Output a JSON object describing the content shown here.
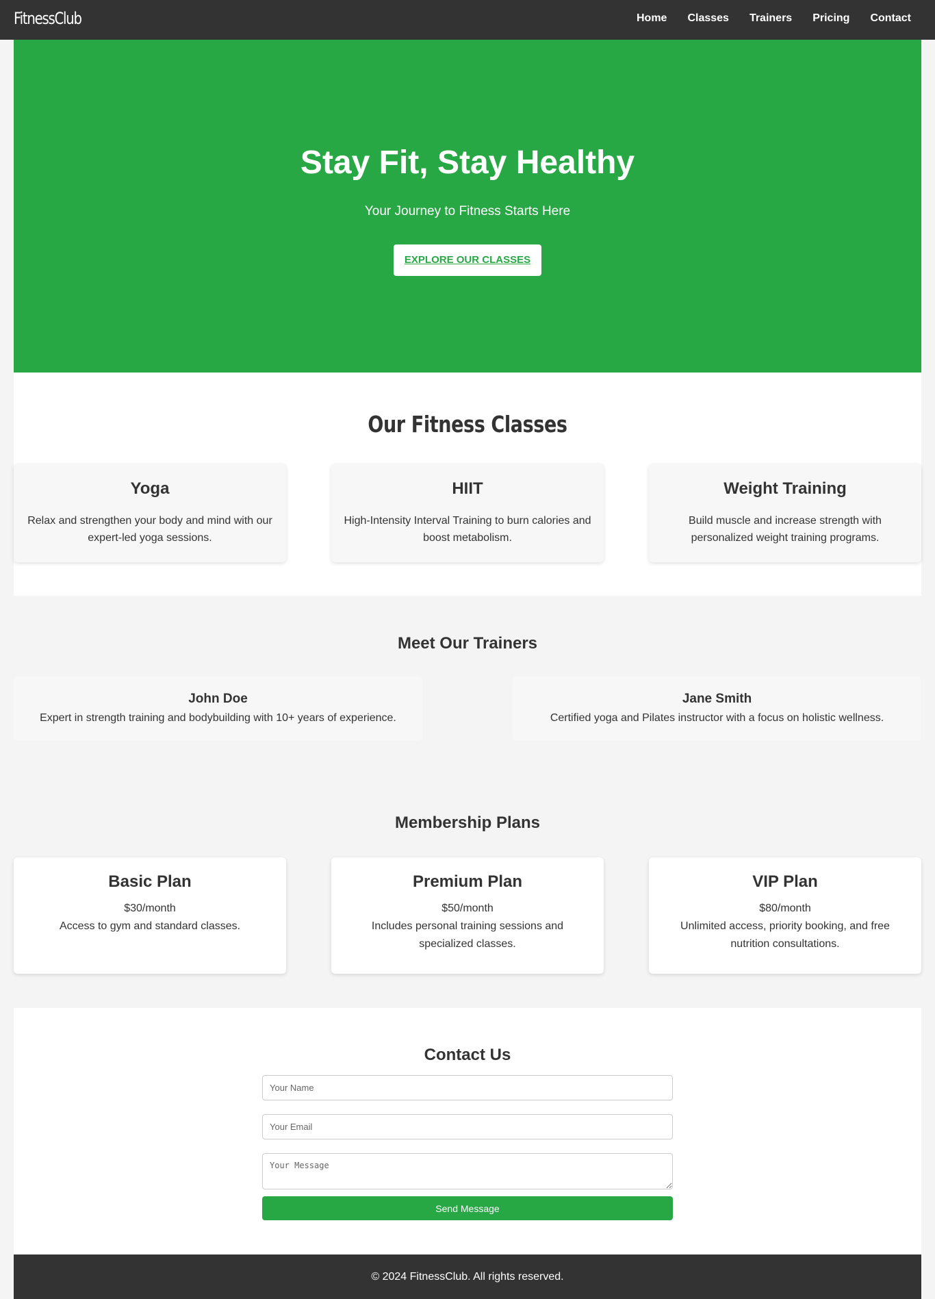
{
  "header": {
    "logo": "FitnessClub",
    "nav": [
      "Home",
      "Classes",
      "Trainers",
      "Pricing",
      "Contact"
    ]
  },
  "hero": {
    "title": "Stay Fit, Stay Healthy",
    "subtitle": "Your Journey to Fitness Starts Here",
    "cta": "EXPLORE OUR CLASSES"
  },
  "classes": {
    "title": "Our Fitness Classes",
    "items": [
      {
        "name": "Yoga",
        "desc": "Relax and strengthen your body and mind with our expert-led yoga sessions."
      },
      {
        "name": "HIIT",
        "desc": "High-Intensity Interval Training to burn calories and boost metabolism."
      },
      {
        "name": "Weight Training",
        "desc": "Build muscle and increase strength with personalized weight training programs."
      }
    ]
  },
  "trainers": {
    "title": "Meet Our Trainers",
    "items": [
      {
        "name": "John Doe",
        "desc": "Expert in strength training and bodybuilding with 10+ years of experience."
      },
      {
        "name": "Jane Smith",
        "desc": "Certified yoga and Pilates instructor with a focus on holistic wellness."
      }
    ]
  },
  "pricing": {
    "title": "Membership Plans",
    "plans": [
      {
        "name": "Basic Plan",
        "price": "$30/month",
        "desc": "Access to gym and standard classes."
      },
      {
        "name": "Premium Plan",
        "price": "$50/month",
        "desc": "Includes personal training sessions and specialized classes."
      },
      {
        "name": "VIP Plan",
        "price": "$80/month",
        "desc": "Unlimited access, priority booking, and free nutrition consultations."
      }
    ]
  },
  "contact": {
    "title": "Contact Us",
    "name_placeholder": "Your Name",
    "email_placeholder": "Your Email",
    "message_placeholder": "Your Message",
    "send_label": "Send Message"
  },
  "footer": {
    "text": "© 2024 FitnessClub. All rights reserved."
  },
  "colors": {
    "brand_green": "#28a745",
    "dark": "#333333"
  }
}
